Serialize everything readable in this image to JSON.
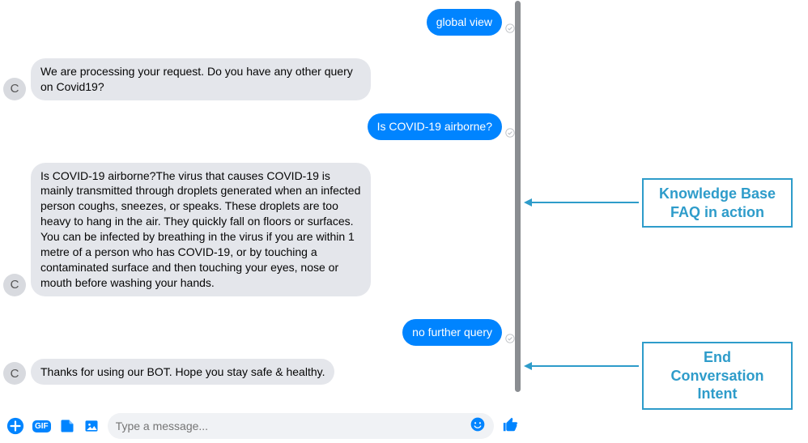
{
  "conversation": {
    "avatar_initial": "C",
    "messages": [
      {
        "kind": "out",
        "text": "global view"
      },
      {
        "kind": "in",
        "text": "We  are processing your request. Do you have any other query on Covid19?"
      },
      {
        "kind": "out",
        "text": "Is COVID-19 airborne?"
      },
      {
        "kind": "in",
        "text": "Is COVID-19 airborne?The virus that causes COVID-19 is mainly transmitted through droplets generated when an infected person coughs, sneezes, or speaks. These droplets are too heavy to hang in the air. They quickly fall on floors or surfaces. You can be infected by breathing in the virus if you are within 1 metre of a person who has COVID-19, or by touching a contaminated surface and then touching your eyes, nose or mouth before washing your hands."
      },
      {
        "kind": "out",
        "text": "no further query"
      },
      {
        "kind": "in",
        "text": "Thanks for using our BOT. Hope you stay safe & healthy."
      }
    ]
  },
  "composer": {
    "placeholder": "Type a message...",
    "gif_label": "GIF"
  },
  "annotations": {
    "kb_faq": "Knowledge Base FAQ in action",
    "end_intent": "End Conversation Intent"
  }
}
